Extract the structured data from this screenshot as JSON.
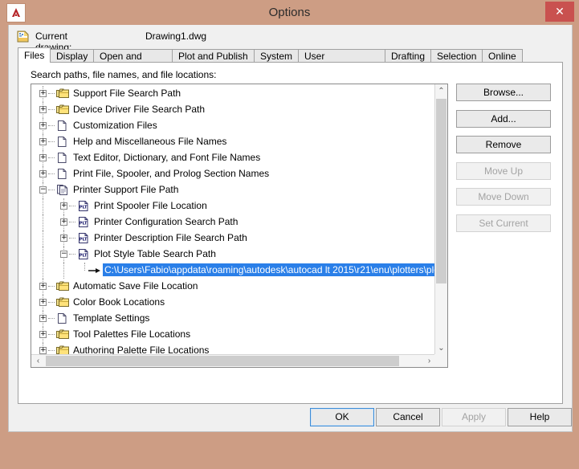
{
  "window": {
    "title": "Options",
    "app_icon": "autocad-a-icon",
    "close_label": "✕",
    "titlebar_color": "#cd9d84",
    "accent_selection_color": "#2a7fe8"
  },
  "current_drawing": {
    "icon": "drawing-file-icon",
    "label": "Current drawing:",
    "value": "Drawing1.dwg"
  },
  "tabs": [
    {
      "label": "Files",
      "active": true
    },
    {
      "label": "Display",
      "active": false
    },
    {
      "label": "Open and Save",
      "active": false
    },
    {
      "label": "Plot and Publish",
      "active": false
    },
    {
      "label": "System",
      "active": false
    },
    {
      "label": "User Preferences",
      "active": false
    },
    {
      "label": "Drafting",
      "active": false
    },
    {
      "label": "Selection",
      "active": false
    },
    {
      "label": "Online",
      "active": false
    }
  ],
  "files_page": {
    "section_label": "Search paths, file names, and file locations:",
    "tree": [
      {
        "label": "Support File Search Path",
        "indent": 0,
        "icon": "folder-stack-icon",
        "expander": "+",
        "selected": false
      },
      {
        "label": "Device Driver File Search Path",
        "indent": 0,
        "icon": "folder-stack-icon",
        "expander": "+",
        "selected": false
      },
      {
        "label": "Customization Files",
        "indent": 0,
        "icon": "file-icon",
        "expander": "+",
        "selected": false
      },
      {
        "label": "Help and Miscellaneous File Names",
        "indent": 0,
        "icon": "file-icon",
        "expander": "+",
        "selected": false
      },
      {
        "label": "Text Editor, Dictionary, and Font File Names",
        "indent": 0,
        "icon": "file-icon",
        "expander": "+",
        "selected": false
      },
      {
        "label": "Print File, Spooler, and Prolog Section Names",
        "indent": 0,
        "icon": "file-icon",
        "expander": "+",
        "selected": false
      },
      {
        "label": "Printer Support File Path",
        "indent": 0,
        "icon": "file-stack-icon",
        "expander": "−",
        "selected": false
      },
      {
        "label": "Print Spooler File Location",
        "indent": 1,
        "icon": "plt-file-icon",
        "expander": "+",
        "selected": false
      },
      {
        "label": "Printer Configuration Search Path",
        "indent": 1,
        "icon": "plt-file-icon",
        "expander": "+",
        "selected": false
      },
      {
        "label": "Printer Description File Search Path",
        "indent": 1,
        "icon": "plt-file-icon",
        "expander": "+",
        "selected": false
      },
      {
        "label": "Plot Style Table Search Path",
        "indent": 1,
        "icon": "plt-file-icon",
        "expander": "−",
        "selected": false
      },
      {
        "label": "C:\\Users\\Fabio\\appdata\\roaming\\autodesk\\autocad lt 2015\\r21\\enu\\plotters\\plot s",
        "indent": 2,
        "icon": "arrow-marker-icon",
        "expander": "",
        "selected": true
      },
      {
        "label": "Automatic Save File Location",
        "indent": 0,
        "icon": "folder-stack-icon",
        "expander": "+",
        "selected": false
      },
      {
        "label": "Color Book Locations",
        "indent": 0,
        "icon": "folder-stack-icon",
        "expander": "+",
        "selected": false
      },
      {
        "label": "Template Settings",
        "indent": 0,
        "icon": "file-icon",
        "expander": "+",
        "selected": false
      },
      {
        "label": "Tool Palettes File Locations",
        "indent": 0,
        "icon": "folder-stack-icon",
        "expander": "+",
        "selected": false
      },
      {
        "label": "Authoring Palette File Locations",
        "indent": 0,
        "icon": "folder-stack-icon",
        "expander": "+",
        "selected": false
      },
      {
        "label": "",
        "indent": 0,
        "icon": "folder-stack-icon",
        "expander": "+",
        "selected": false
      }
    ],
    "side_buttons": [
      {
        "label": "Browse...",
        "enabled": true
      },
      {
        "label": "Add...",
        "enabled": true
      },
      {
        "label": "Remove",
        "enabled": true
      },
      {
        "label": "Move Up",
        "enabled": false
      },
      {
        "label": "Move Down",
        "enabled": false
      },
      {
        "label": "Set Current",
        "enabled": false
      }
    ],
    "vscrollbar": {
      "up_glyph": "⌃",
      "down_glyph": "⌄"
    },
    "hscrollbar": {
      "left_glyph": "‹",
      "right_glyph": "›"
    }
  },
  "dialog_buttons": [
    {
      "label": "OK",
      "enabled": true,
      "focused": true
    },
    {
      "label": "Cancel",
      "enabled": true,
      "focused": false
    },
    {
      "label": "Apply",
      "enabled": false,
      "focused": false
    },
    {
      "label": "Help",
      "enabled": true,
      "focused": false
    }
  ]
}
